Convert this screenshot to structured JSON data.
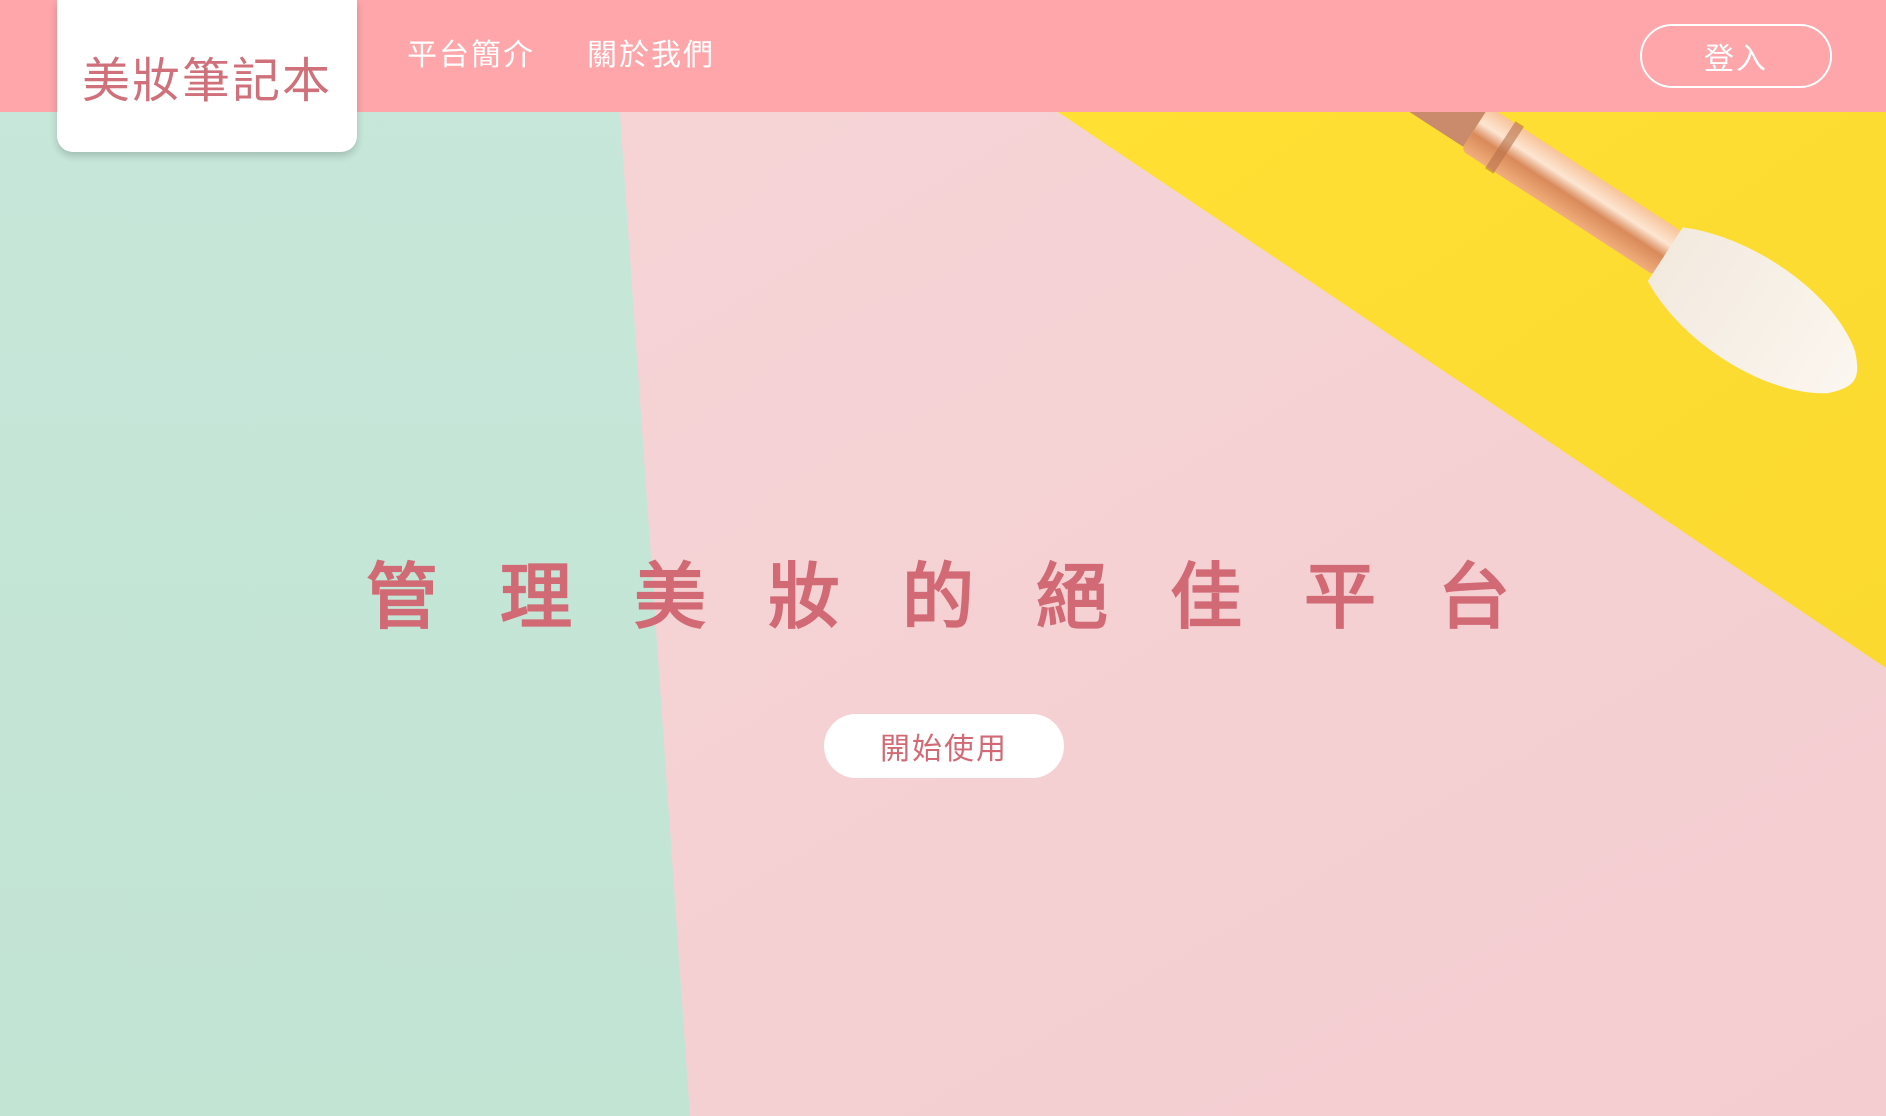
{
  "logo": {
    "text": "美妝筆記本"
  },
  "nav": {
    "items": [
      {
        "label": "平台簡介"
      },
      {
        "label": "關於我們"
      }
    ]
  },
  "header": {
    "login_label": "登入"
  },
  "hero": {
    "title": "管理美妝的絕佳平台",
    "cta_label": "開始使用"
  },
  "colors": {
    "topbar": "#fea6aa",
    "accent_text": "#d26a75",
    "mint_panel": "#c6e6d8",
    "pink_panel": "#f6d4d6",
    "yellow_panel": "#fedc34"
  },
  "background": {
    "description_icon": "makeup-brush-icon"
  }
}
